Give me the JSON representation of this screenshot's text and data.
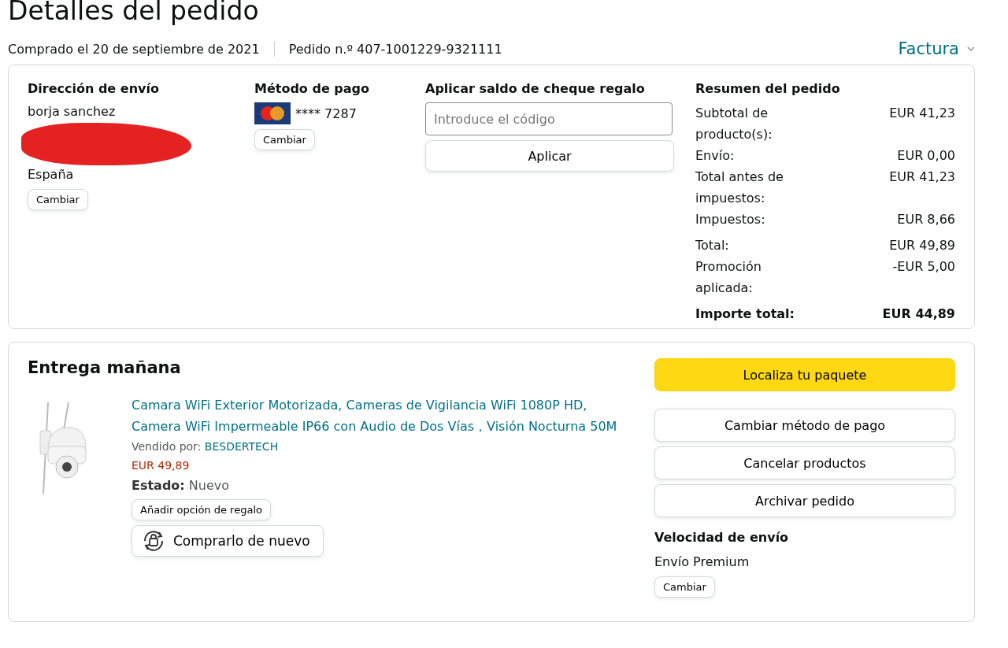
{
  "title": "Detalles del pedido",
  "order_meta": {
    "purchased": "Comprado el 20 de septiembre de 2021",
    "order_number": "Pedido n.º 407-1001229-9321111",
    "invoice": "Factura"
  },
  "shipping_address": {
    "heading": "Dirección de envío",
    "name": "borja sanchez",
    "country": "España",
    "change_button": "Cambiar"
  },
  "payment_method": {
    "heading": "Método de pago",
    "card": "**** 7287",
    "change_button": "Cambiar"
  },
  "gift_card": {
    "heading": "Aplicar saldo de cheque regalo",
    "placeholder": "Introduce el código",
    "apply_button": "Aplicar"
  },
  "order_summary": {
    "heading": "Resumen del pedido",
    "rows": [
      {
        "label": "Subtotal de producto(s):",
        "value": "EUR 41,23",
        "kind": "normal"
      },
      {
        "label": "Envío:",
        "value": "EUR 0,00",
        "kind": "normal"
      },
      {
        "label": "Total antes de impuestos:",
        "value": "EUR 41,23",
        "kind": "normal"
      },
      {
        "label": "Impuestos:",
        "value": "EUR 8,66",
        "kind": "normal"
      },
      {
        "label": "Total:",
        "value": "EUR 49,89",
        "kind": "spaced"
      },
      {
        "label": "Promoción aplicada:",
        "value": "-EUR 5,00",
        "kind": "normal"
      },
      {
        "label": "Importe total:",
        "value": "EUR 44,89",
        "kind": "grand"
      }
    ]
  },
  "delivery": {
    "heading": "Entrega mañana",
    "product": {
      "title": "Camara WiFi Exterior Motorizada, Cameras de Vigilancia WiFi 1080P HD, Camera WiFi Impermeable IP66 con Audio de Dos Vías，Visión Nocturna 50M",
      "sold_by_label": "Vendido por:",
      "seller": "BESDERTECH",
      "price": "EUR 49,89",
      "condition": "**Estado:** Nuevo",
      "gift_button": "Añadir opción de regalo",
      "buy_again_button": "Comprarlo de nuevo"
    },
    "actions": [
      {
        "label": "Localiza tu paquete",
        "kind": "primary"
      },
      {
        "label": "Cambiar método de pago",
        "kind": "secondary"
      },
      {
        "label": "Cancelar productos",
        "kind": "secondary"
      },
      {
        "label": "Archivar pedido",
        "kind": "secondary"
      }
    ],
    "shipping_speed": {
      "heading": "Velocidad de envío",
      "value": "Envío Premium",
      "change_button": "Cambiar"
    }
  }
}
